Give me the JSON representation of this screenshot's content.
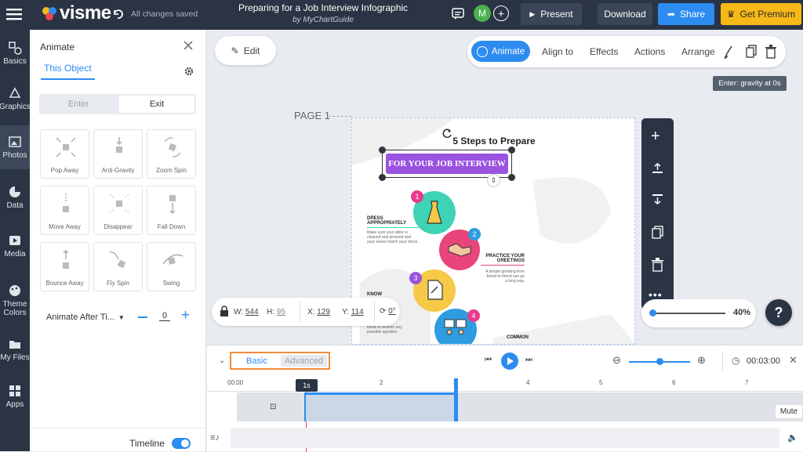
{
  "topbar": {
    "logo": "visme",
    "saved_status": "All changes saved",
    "project_title": "Preparing for a Job Interview Infographic",
    "project_author": "by MyChartGuide",
    "avatar_initial": "M",
    "present_label": "Present",
    "download_label": "Download",
    "share_label": "Share",
    "premium_label": "Get Premium"
  },
  "rail": [
    {
      "label": "Basics",
      "icon": "basics-icon"
    },
    {
      "label": "Graphics",
      "icon": "graphics-icon"
    },
    {
      "label": "Photos",
      "icon": "photos-icon"
    },
    {
      "label": "Data",
      "icon": "data-icon"
    },
    {
      "label": "Media",
      "icon": "media-icon"
    },
    {
      "label": "Theme Colors",
      "icon": "palette-icon"
    },
    {
      "label": "My Files",
      "icon": "files-icon"
    },
    {
      "label": "Apps",
      "icon": "apps-icon"
    }
  ],
  "animate_panel": {
    "title": "Animate",
    "tab": "This Object",
    "enter_label": "Enter",
    "exit_label": "Exit",
    "effects": [
      "Pop Away",
      "Anti-Gravity",
      "Zoom Spin",
      "Move Away",
      "Disappear",
      "Fall Down",
      "Bounce Away",
      "Fly Spin",
      "Swing"
    ],
    "timing_label": "Animate After Ti...",
    "timing_value": "0",
    "timeline_label": "Timeline",
    "timeline_on": true
  },
  "canvas": {
    "edit_label": "Edit",
    "toolbar": {
      "animate": "Animate",
      "align": "Align to",
      "effects": "Effects",
      "actions": "Actions",
      "arrange": "Arrange"
    },
    "tooltip": "Enter: gravity at 0s",
    "page_label": "PAGE 1",
    "infographic": {
      "title": "5 Steps to Prepare",
      "banner": "FOR YOUR JOB INTERVIEW",
      "steps": [
        {
          "num": "1",
          "heading": "DRESS APPROPRIATELY",
          "text": "Make sure your attire is cleaned and pressed and your shoes match your dress."
        },
        {
          "num": "2",
          "heading": "PRACTICE YOUR GREETINGS",
          "text": "A simple greeting from friend to friend can go a long way."
        },
        {
          "num": "3",
          "heading": "KNOW",
          "text": "Ideas to answer any possible question"
        },
        {
          "num": "4",
          "heading": "COMMON",
          "text": ""
        }
      ]
    },
    "dims": {
      "w_label": "W:",
      "w": "544",
      "h_label": "H:",
      "h": "95",
      "x_label": "X:",
      "x": "129",
      "y_label": "Y:",
      "y": "114",
      "rotation": "0°"
    },
    "zoom_percent": "40%",
    "help": "?"
  },
  "timeline": {
    "basic_label": "Basic",
    "advanced_label": "Advanced",
    "total_time": "00:03:00",
    "marker": "1s",
    "ticks": [
      "00:00",
      "1",
      "2",
      "3",
      "4",
      "5",
      "6",
      "7"
    ],
    "mute_label": "Mute"
  },
  "colors": {
    "accent": "#2d8cf0",
    "premium": "#f7b917",
    "banner": "#9b52e0",
    "topbar": "#2a3444"
  }
}
